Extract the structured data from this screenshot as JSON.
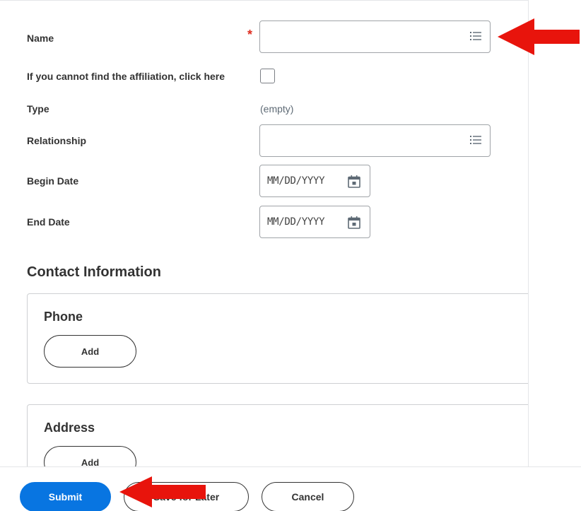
{
  "form": {
    "name_label": "Name",
    "required_marker": "*",
    "affiliation_label": "If you cannot find the affiliation, click here",
    "type_label": "Type",
    "type_value": "(empty)",
    "relationship_label": "Relationship",
    "begin_date_label": "Begin Date",
    "begin_date_placeholder": "MM/DD/YYYY",
    "end_date_label": "End Date",
    "end_date_placeholder": "MM/DD/YYYY"
  },
  "contact": {
    "title": "Contact Information",
    "phone": {
      "title": "Phone",
      "add_label": "Add"
    },
    "address": {
      "title": "Address",
      "add_label": "Add"
    }
  },
  "footer": {
    "submit_label": "Submit",
    "save_later_label": "Save for Later",
    "cancel_label": "Cancel"
  },
  "colors": {
    "primary": "#0875e1",
    "required": "#de2e21",
    "annotation_arrow": "#e8140c"
  },
  "icons": {
    "prompt": "list-icon",
    "date": "calendar-icon"
  }
}
